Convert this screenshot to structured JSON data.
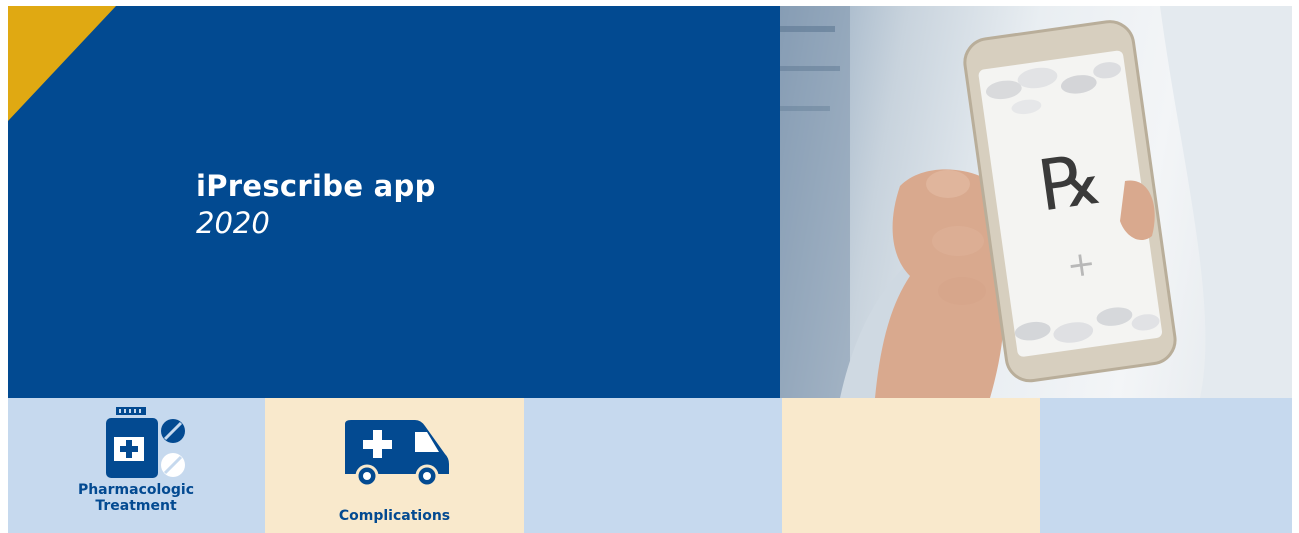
{
  "hero": {
    "title": "iPrescribe app",
    "year": "2020",
    "background_color": "#024a91",
    "accent_color": "#e0a912"
  },
  "photo": {
    "rx_symbol": "℞",
    "plus_symbol": "+"
  },
  "tiles": [
    {
      "label": "Pharmacologic Treatment",
      "icon": "medicine-bottle-pills-icon",
      "color": "#c6d9ee"
    },
    {
      "label": "Complications",
      "icon": "ambulance-icon",
      "color": "#f9e9cc"
    },
    {
      "label": "",
      "color": "#c6d9ee"
    },
    {
      "label": "",
      "color": "#f9e9cc"
    },
    {
      "label": "",
      "color": "#c6d9ee"
    }
  ]
}
